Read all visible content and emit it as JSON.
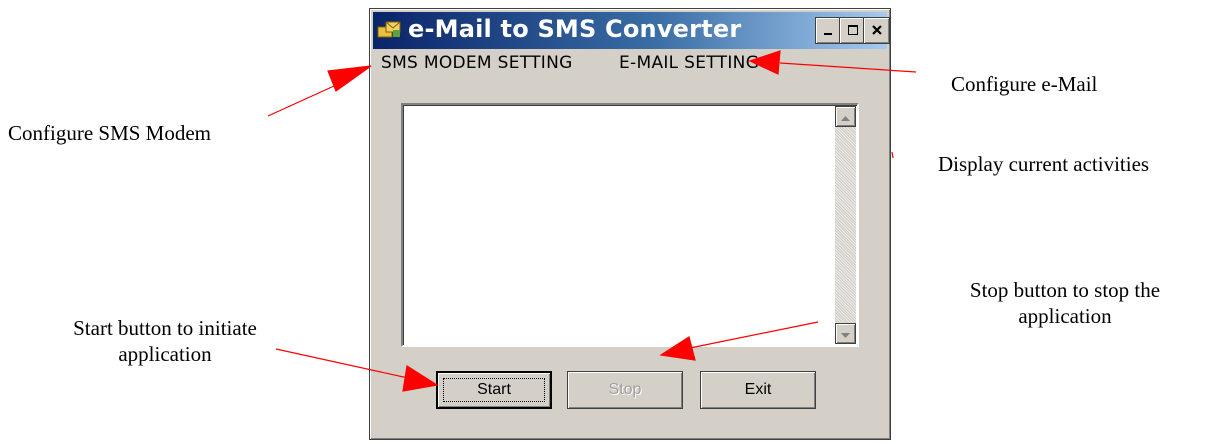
{
  "window": {
    "title": "e-Mail to SMS Converter",
    "menu": {
      "sms_modem_setting": "SMS MODEM SETTING",
      "email_setting": "E-MAIL SETTING"
    },
    "buttons": {
      "start": "Start",
      "stop": "Stop",
      "exit": "Exit"
    },
    "stop_enabled": false,
    "activity_log": ""
  },
  "annotations": {
    "configure_sms": "Configure SMS Modem",
    "configure_email": "Configure e-Mail",
    "display_activities": "Display current activities",
    "start_line1": "Start button to initiate",
    "start_line2": "application",
    "stop_line1": "Stop button to stop the",
    "stop_line2": "application"
  },
  "colors": {
    "arrow": "#ff0000",
    "title_start": "#0a246a",
    "title_end": "#a6caf0",
    "face": "#d4d0c8"
  }
}
